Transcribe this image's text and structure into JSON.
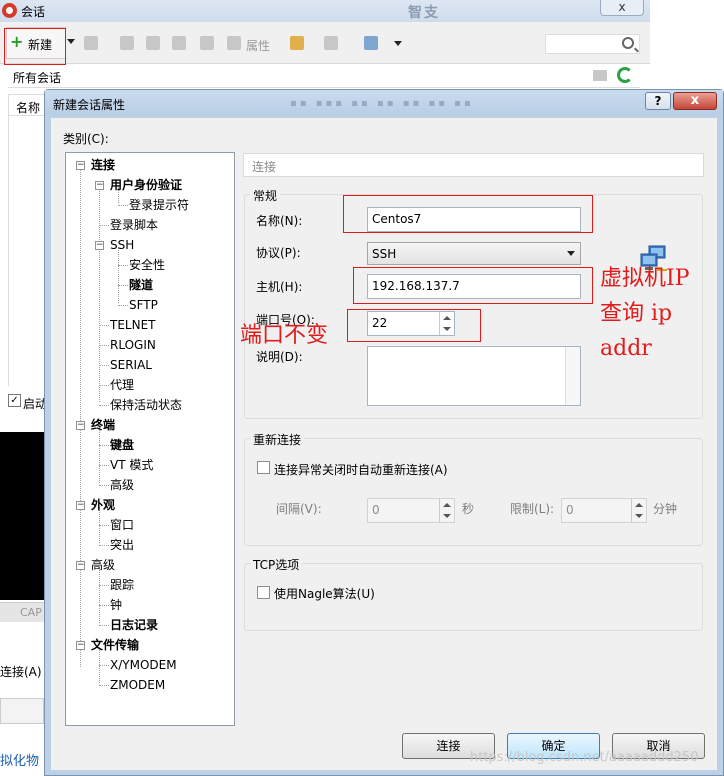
{
  "bg_window": {
    "title": "会话",
    "close_symbol": "x",
    "blur_text": "智支",
    "toolbar": {
      "new_label": "新建",
      "properties_label": "属性"
    },
    "all_sessions_label": "所有会话",
    "name_column": "名称",
    "startup_check": "✓",
    "startup_label": "启动",
    "cap_label": "CAP",
    "connect_label": "连接(A)",
    "bottom_text": "拟化物"
  },
  "dialog": {
    "title": "新建会话属性",
    "help_symbol": "?",
    "close_symbol": "x",
    "category_label": "类别(C):",
    "tree": [
      {
        "label": "连接",
        "level": 0,
        "bold": true,
        "expanded": true
      },
      {
        "label": "用户身份验证",
        "level": 1,
        "bold": true,
        "expanded": true
      },
      {
        "label": "登录提示符",
        "level": 2,
        "bold": false
      },
      {
        "label": "登录脚本",
        "level": 1,
        "bold": false
      },
      {
        "label": "SSH",
        "level": 1,
        "bold": false,
        "expanded": true
      },
      {
        "label": "安全性",
        "level": 2,
        "bold": false
      },
      {
        "label": "隧道",
        "level": 2,
        "bold": true
      },
      {
        "label": "SFTP",
        "level": 2,
        "bold": false
      },
      {
        "label": "TELNET",
        "level": 1,
        "bold": false
      },
      {
        "label": "RLOGIN",
        "level": 1,
        "bold": false
      },
      {
        "label": "SERIAL",
        "level": 1,
        "bold": false
      },
      {
        "label": "代理",
        "level": 1,
        "bold": false
      },
      {
        "label": "保持活动状态",
        "level": 1,
        "bold": false
      },
      {
        "label": "终端",
        "level": 0,
        "bold": true,
        "expanded": true
      },
      {
        "label": "键盘",
        "level": 1,
        "bold": true
      },
      {
        "label": "VT 模式",
        "level": 1,
        "bold": false
      },
      {
        "label": "高级",
        "level": 1,
        "bold": false
      },
      {
        "label": "外观",
        "level": 0,
        "bold": true,
        "expanded": true
      },
      {
        "label": "窗口",
        "level": 1,
        "bold": false
      },
      {
        "label": "突出",
        "level": 1,
        "bold": false
      },
      {
        "label": "高级",
        "level": 0,
        "bold": false,
        "expanded": true
      },
      {
        "label": "跟踪",
        "level": 1,
        "bold": false
      },
      {
        "label": "钟",
        "level": 1,
        "bold": false
      },
      {
        "label": "日志记录",
        "level": 1,
        "bold": true
      },
      {
        "label": "文件传输",
        "level": 0,
        "bold": true,
        "expanded": true
      },
      {
        "label": "X/YMODEM",
        "level": 1,
        "bold": false
      },
      {
        "label": "ZMODEM",
        "level": 1,
        "bold": false
      }
    ],
    "panel_header": "连接",
    "general": {
      "title": "常规",
      "name_label": "名称(N):",
      "name_value": "Centos7",
      "protocol_label": "协议(P):",
      "protocol_value": "SSH",
      "host_label": "主机(H):",
      "host_value": "192.168.137.7",
      "port_label": "端口号(O):",
      "port_value": "22",
      "desc_label": "说明(D):",
      "desc_value": ""
    },
    "reconnect": {
      "title": "重新连接",
      "auto_label": "连接异常关闭时自动重新连接(A)",
      "interval_label": "间隔(V):",
      "interval_value": "0",
      "interval_unit": "秒",
      "limit_label": "限制(L):",
      "limit_value": "0",
      "limit_unit": "分钟"
    },
    "tcp": {
      "title": "TCP选项",
      "nagle_label": "使用Nagle算法(U)"
    },
    "buttons": {
      "connect": "连接",
      "ok": "确定",
      "cancel": "取消"
    }
  },
  "annotations": {
    "vm_ip_line1": "虚拟机IP",
    "vm_ip_line2": "查询 ip",
    "vm_ip_line3": "addr",
    "port_note": "端口不变"
  },
  "watermark": "https://blog.csdn.net/aaaaaddd250",
  "colors": {
    "annotation": "#e01b1b",
    "accent": "#3c7fb1"
  }
}
